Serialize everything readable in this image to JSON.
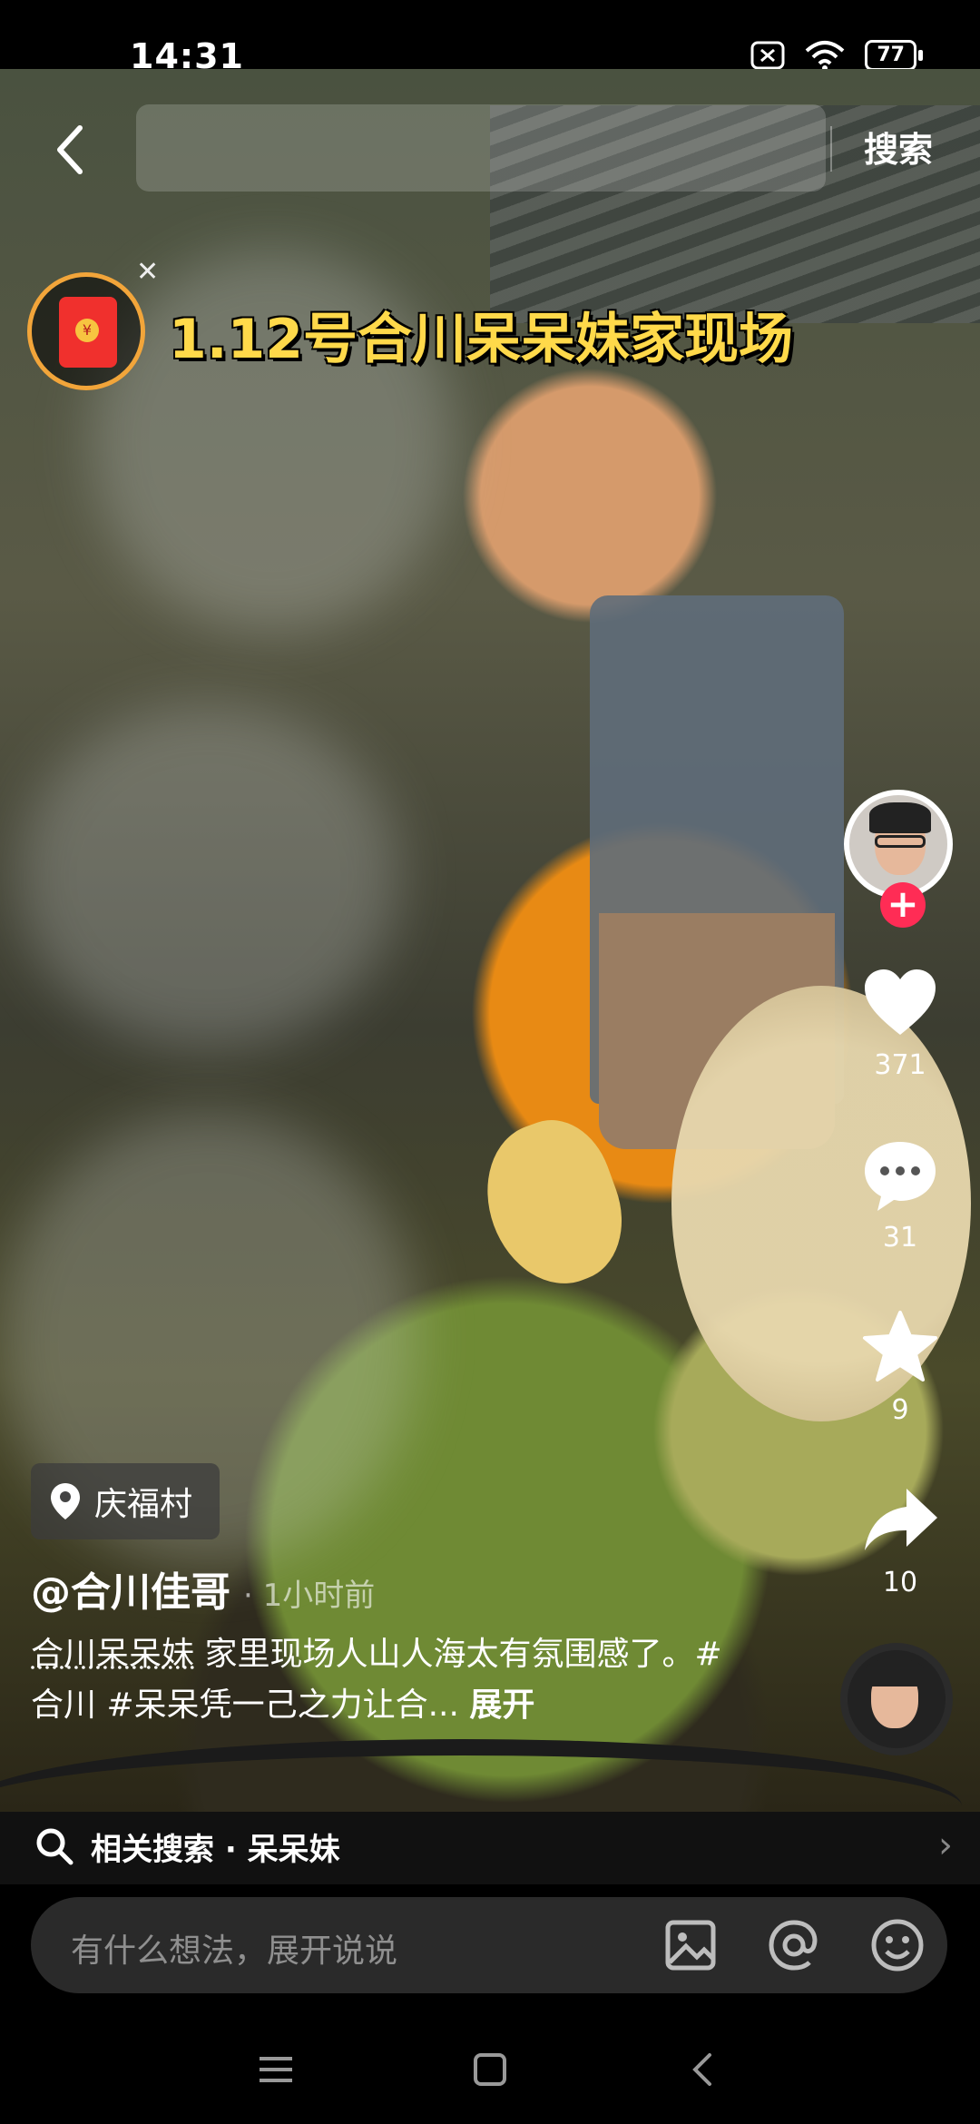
{
  "status_bar": {
    "time": "14:31",
    "battery": "77"
  },
  "top_bar": {
    "search_placeholder": "",
    "search_button": "搜索"
  },
  "overlay": {
    "caption": "1.12号合川呆呆妹家现场"
  },
  "actions": {
    "likes": "371",
    "comments": "31",
    "favorites": "9",
    "shares": "10"
  },
  "post": {
    "location": "庆福村",
    "author": "@合川佳哥",
    "time": "· 1小时前",
    "desc_tag": "合川呆呆妹",
    "desc_text": " 家里现场人山人海太有氛围感了。#合川 #呆呆凭一己之力让合... ",
    "desc_more": "展开"
  },
  "related": {
    "label": "相关搜索 · 呆呆妹"
  },
  "comment": {
    "placeholder": "有什么想法，展开说说"
  },
  "colors": {
    "accent": "#ff2c55",
    "caption": "#ffd94a",
    "redpack": "#f0302d"
  }
}
